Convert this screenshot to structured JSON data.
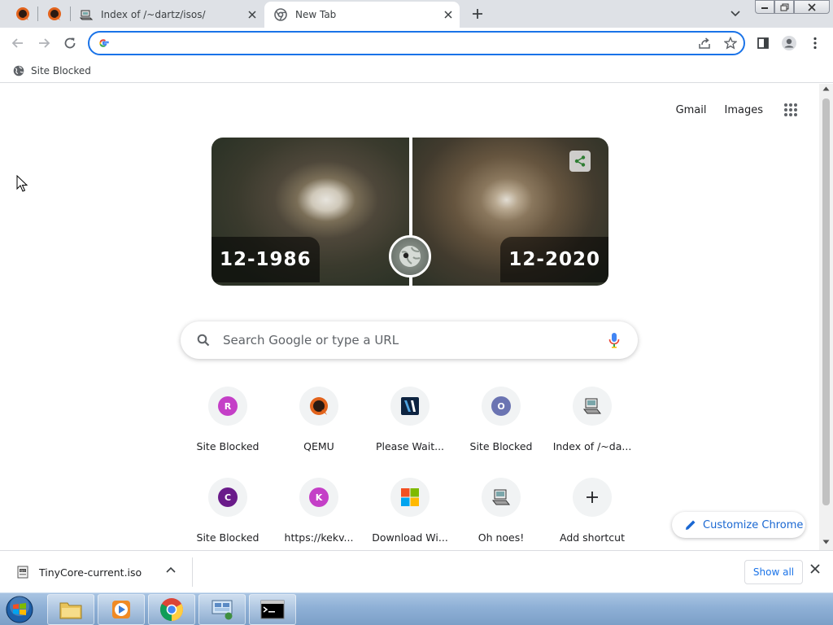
{
  "tabs": [
    {
      "title": "",
      "favicon": "qemu-icon"
    },
    {
      "title": "",
      "favicon": "qemu-icon"
    },
    {
      "title": "Index of /~dartz/isos/",
      "favicon": "server-icon"
    },
    {
      "title": "New Tab",
      "favicon": "chrome-icon",
      "active": true
    }
  ],
  "toolbar": {
    "omnibox_value": "",
    "omnibox_placeholder": ""
  },
  "bookmarks": [
    {
      "label": "Site Blocked",
      "icon": "globe-icon"
    }
  ],
  "ntp": {
    "links": {
      "gmail": "Gmail",
      "images": "Images"
    },
    "doodle": {
      "left_date": "12-1986",
      "right_date": "12-2020"
    },
    "search_placeholder": "Search Google or type a URL",
    "shortcuts": [
      {
        "title": "Site Blocked",
        "letter": "R",
        "color": "#c43fc7"
      },
      {
        "title": "QEMU",
        "icon": "qemu-icon"
      },
      {
        "title": "Please Wait...",
        "icon": "v-logo-icon"
      },
      {
        "title": "Site Blocked",
        "letter": "O",
        "color": "#6b74b2"
      },
      {
        "title": "Index of /~da...",
        "icon": "server-icon"
      },
      {
        "title": "Site Blocked",
        "letter": "C",
        "color": "#6a1b8a"
      },
      {
        "title": "https://kekv...",
        "letter": "K",
        "color": "#c43fc7"
      },
      {
        "title": "Download Wi...",
        "icon": "windows-logo-icon"
      },
      {
        "title": "Oh noes!",
        "icon": "server-icon"
      },
      {
        "title": "Add shortcut",
        "icon": "plus-icon"
      }
    ],
    "customize_label": "Customize Chrome"
  },
  "downloads": {
    "file_name": "TinyCore-current.iso",
    "show_all_label": "Show all"
  },
  "colors": {
    "accent": "#1a73e8",
    "tab_strip": "#dee1e6"
  }
}
